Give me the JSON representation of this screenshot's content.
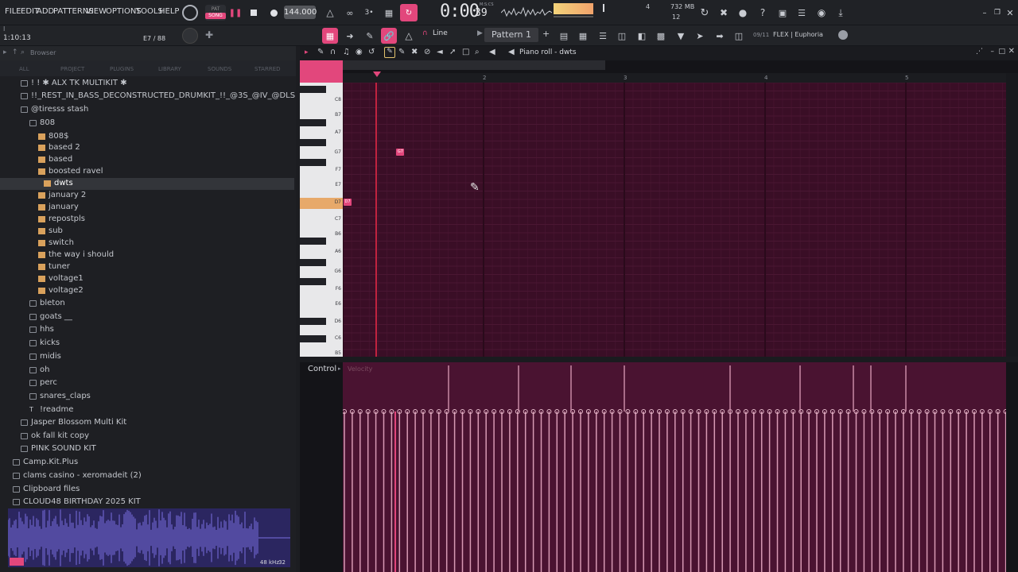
{
  "menu": [
    "FILE",
    "EDIT",
    "ADD",
    "PATTERNS",
    "VIEW",
    "OPTIONS",
    "TOOLS",
    "HELP"
  ],
  "transport": {
    "mode_top": "PAT",
    "mode_bottom": "SONG",
    "tempo": "144.000",
    "time": "0:00",
    "time_sub": "39",
    "time_unit": "M:S:CS",
    "cpu_num": "4",
    "memory": "732 MB",
    "voices": "12"
  },
  "hint_bar": {
    "position": "1:10:13",
    "note": "E7 / 88"
  },
  "toolbar2": {
    "snap": "Line",
    "pattern": "Pattern 1",
    "plugin_counter": "09/11",
    "plugin_name": "FLEX | Euphoria"
  },
  "browser": {
    "title": "Browser",
    "tabs": [
      "ALL",
      "PROJECT",
      "PLUGINS",
      "LIBRARY",
      "SOUNDS",
      "STARRED"
    ],
    "items": [
      {
        "label": "! ! ✱ ALX TK MULTIKIT ✱",
        "depth": 1,
        "type": "folder"
      },
      {
        "label": "!!_REST_IN_BASS_DECONSTRUCTED_DRUMKIT_!!_@3S_@IV_@DLS",
        "depth": 1,
        "type": "folder"
      },
      {
        "label": "@tiresss stash",
        "depth": 1,
        "type": "folder"
      },
      {
        "label": "808",
        "depth": 2,
        "type": "folder"
      },
      {
        "label": "808$",
        "depth": 3,
        "type": "project"
      },
      {
        "label": "based 2",
        "depth": 3,
        "type": "project"
      },
      {
        "label": "based",
        "depth": 3,
        "type": "project"
      },
      {
        "label": "boosted ravel",
        "depth": 3,
        "type": "project"
      },
      {
        "label": "dwts",
        "depth": 4,
        "type": "project",
        "selected": true
      },
      {
        "label": "january 2",
        "depth": 3,
        "type": "project"
      },
      {
        "label": "january",
        "depth": 3,
        "type": "project"
      },
      {
        "label": "repostpls",
        "depth": 3,
        "type": "project"
      },
      {
        "label": "sub",
        "depth": 3,
        "type": "project"
      },
      {
        "label": "switch",
        "depth": 3,
        "type": "project"
      },
      {
        "label": "the way i should",
        "depth": 3,
        "type": "project"
      },
      {
        "label": "tuner",
        "depth": 3,
        "type": "project"
      },
      {
        "label": "voltage1",
        "depth": 3,
        "type": "project"
      },
      {
        "label": "voltage2",
        "depth": 3,
        "type": "project"
      },
      {
        "label": "bleton",
        "depth": 2,
        "type": "folder"
      },
      {
        "label": "goats __",
        "depth": 2,
        "type": "folder"
      },
      {
        "label": "hhs",
        "depth": 2,
        "type": "folder"
      },
      {
        "label": "kicks",
        "depth": 2,
        "type": "folder"
      },
      {
        "label": "midis",
        "depth": 2,
        "type": "folder"
      },
      {
        "label": "oh",
        "depth": 2,
        "type": "folder"
      },
      {
        "label": "perc",
        "depth": 2,
        "type": "folder"
      },
      {
        "label": "snares_claps",
        "depth": 2,
        "type": "folder"
      },
      {
        "label": "!readme",
        "depth": 2,
        "type": "text"
      },
      {
        "label": "Jasper Blossom Multi Kit",
        "depth": 1,
        "type": "folder"
      },
      {
        "label": "ok fall kit copy",
        "depth": 1,
        "type": "folder"
      },
      {
        "label": "PINK SOUND KIT",
        "depth": 1,
        "type": "folder"
      },
      {
        "label": "Camp.Kit.Plus",
        "depth": 0,
        "type": "folder"
      },
      {
        "label": "clams casino - xeromadeit (2)",
        "depth": 0,
        "type": "folder"
      },
      {
        "label": "Clipboard files",
        "depth": 0,
        "type": "folder"
      },
      {
        "label": "CLOUD48 BIRTHDAY 2025 KIT",
        "depth": 0,
        "type": "folder"
      }
    ],
    "sample_rate": "48 kHz",
    "bit_depth": "32"
  },
  "pianoroll": {
    "title": "Piano roll - dwts",
    "timeline": [
      "2",
      "3",
      "4",
      "5"
    ],
    "keys": [
      "C8",
      "B7",
      "A7",
      "G7",
      "F7",
      "E7",
      "D7",
      "C7",
      "B6",
      "A6",
      "G6",
      "F6",
      "E6",
      "D6",
      "C6",
      "B5"
    ],
    "highlighted_key": "D7",
    "notes": [
      {
        "label": "G7",
        "key": "G7",
        "step": 4
      },
      {
        "label": "D7",
        "key": "D7",
        "step": 0
      }
    ],
    "control_label": "Control",
    "control_param": "Velocity"
  },
  "colors": {
    "accent": "#e2477c",
    "grid": "#3a0e26",
    "velocity_bg": "#4a1331",
    "folder": "#d9a15c",
    "waveform": "#7a6ee0"
  }
}
